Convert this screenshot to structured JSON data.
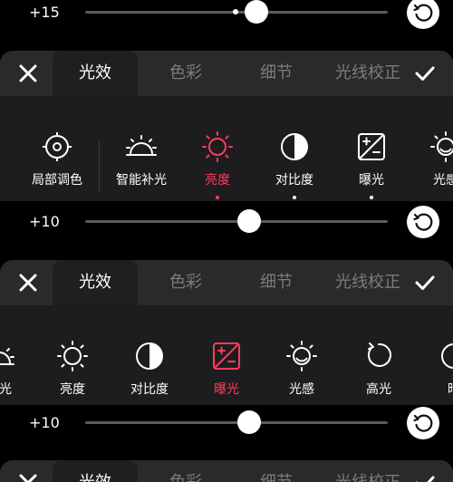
{
  "colors": {
    "accent": "#ff3b5c",
    "panel": "#1d1d1f",
    "tabbar": "#2a2a2c",
    "inactive": "#7c7c7f"
  },
  "slider1": {
    "value_label": "+15",
    "level": 0.57
  },
  "slider2": {
    "value_label": "+10",
    "level": 0.54
  },
  "slider3": {
    "value_label": "+10",
    "level": 0.54
  },
  "panel1": {
    "tabs": [
      "光效",
      "色彩",
      "细节",
      "光线校正"
    ],
    "tools": [
      {
        "label": "局部调色",
        "icon": "target-icon"
      },
      {
        "label": "智能补光",
        "icon": "sunrise-icon"
      },
      {
        "label": "亮度",
        "icon": "sun-icon"
      },
      {
        "label": "对比度",
        "icon": "contrast-icon"
      },
      {
        "label": "曝光",
        "icon": "exposure-icon"
      },
      {
        "label": "光感",
        "icon": "light-sense-icon"
      }
    ]
  },
  "panel2": {
    "tabs": [
      "光效",
      "色彩",
      "细节",
      "光线校正"
    ],
    "tools": [
      {
        "label": "补光",
        "icon": "sunrise-icon"
      },
      {
        "label": "亮度",
        "icon": "sun-icon"
      },
      {
        "label": "对比度",
        "icon": "contrast-icon"
      },
      {
        "label": "曝光",
        "icon": "exposure-icon"
      },
      {
        "label": "光感",
        "icon": "light-sense-icon"
      },
      {
        "label": "高光",
        "icon": "highlight-icon"
      },
      {
        "label": "暗",
        "icon": "shadow-icon"
      }
    ]
  },
  "panel3": {
    "tabs": [
      "光效",
      "色彩",
      "细节",
      "光线校正"
    ]
  }
}
